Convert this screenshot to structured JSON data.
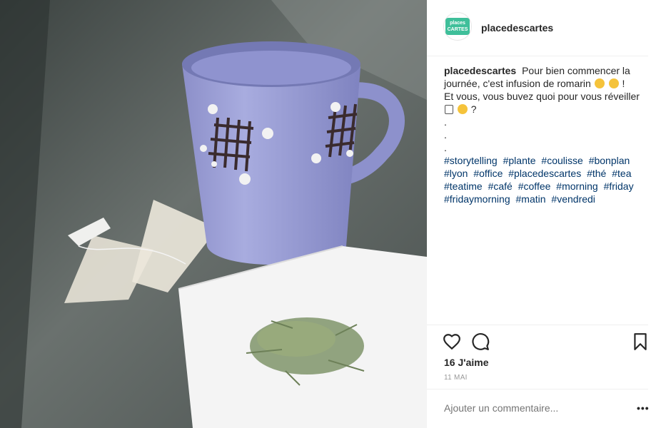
{
  "post": {
    "username": "placedescartes",
    "avatar_text": "places CARTES",
    "caption": {
      "user": "placedescartes",
      "line1": "Pour bien commencer la journée, c'est infusion de romarin",
      "line1_end": " !",
      "line2": "Et vous, vous buvez quoi pour vous réveiller",
      "line2_end": " ?",
      "dots": [
        ".",
        ".",
        "."
      ],
      "hashtags": [
        "#storytelling",
        "#plante",
        "#coulisse",
        "#bonplan",
        "#lyon",
        "#office",
        "#placedescartes",
        "#thé",
        "#tea",
        "#teatime",
        "#café",
        "#coffee",
        "#morning",
        "#friday",
        "#fridaymorning",
        "#matin",
        "#vendredi"
      ]
    },
    "likes_text": "16 J'aime",
    "date": "11 MAI",
    "comment_placeholder": "Ajouter un commentaire...",
    "more_label": "•••",
    "accent_color": "#003569"
  },
  "icons": [
    "heart-icon",
    "comment-icon",
    "bookmark-icon",
    "smile-emoji",
    "yum-emoji",
    "coffee-cup-emoji"
  ]
}
